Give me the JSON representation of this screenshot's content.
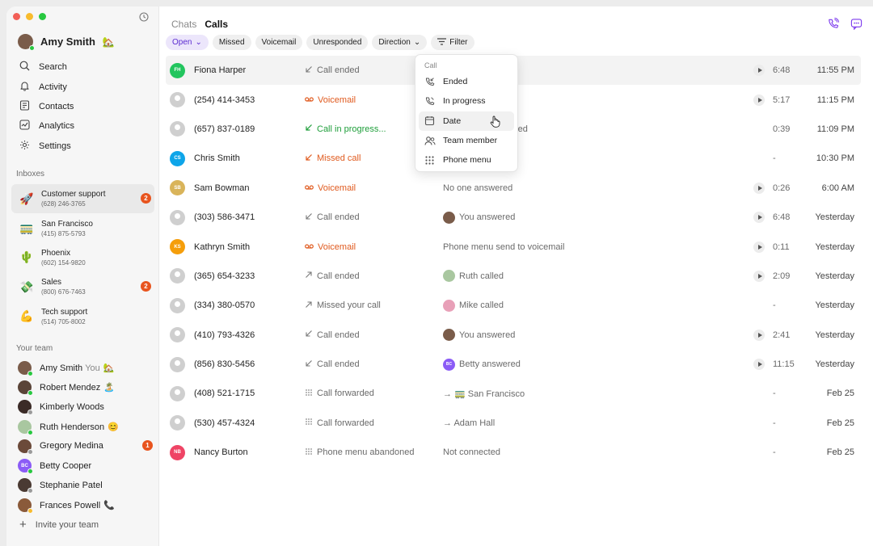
{
  "window": {
    "traffic_lights": [
      "#f25f57",
      "#f8bb2d",
      "#27c83f"
    ]
  },
  "user": {
    "name": "Amy Smith",
    "emoji": "🏡"
  },
  "nav": [
    {
      "label": "Search",
      "icon": "search-icon"
    },
    {
      "label": "Activity",
      "icon": "bell-icon"
    },
    {
      "label": "Contacts",
      "icon": "contacts-icon"
    },
    {
      "label": "Analytics",
      "icon": "analytics-icon"
    },
    {
      "label": "Settings",
      "icon": "gear-icon"
    }
  ],
  "inboxes_label": "Inboxes",
  "inboxes": [
    {
      "name": "Customer support",
      "phone": "(628) 246-3765",
      "emoji": "🚀",
      "badge": "2",
      "active": true
    },
    {
      "name": "San Francisco",
      "phone": "(415) 875-5793",
      "emoji": "🚃",
      "badge": "",
      "active": false
    },
    {
      "name": "Phoenix",
      "phone": "(602) 154-9820",
      "emoji": "🌵",
      "badge": "",
      "active": false
    },
    {
      "name": "Sales",
      "phone": "(800) 676-7463",
      "emoji": "💸",
      "badge": "2",
      "active": false
    },
    {
      "name": "Tech support",
      "phone": "(514) 705-8002",
      "emoji": "💪",
      "badge": "",
      "active": false
    }
  ],
  "team_label": "Your team",
  "team": [
    {
      "name": "Amy Smith",
      "you": "You",
      "emoji": "🏡",
      "color": "#7a5c4a",
      "status": "#27c83f",
      "badge": ""
    },
    {
      "name": "Robert Mendez",
      "you": "",
      "emoji": "🏝️",
      "color": "#5a4438",
      "status": "#27c83f",
      "badge": ""
    },
    {
      "name": "Kimberly Woods",
      "you": "",
      "emoji": "",
      "color": "#3b2b27",
      "status": "#9a9a9a",
      "badge": ""
    },
    {
      "name": "Ruth Henderson",
      "you": "",
      "emoji": "😊",
      "color": "#a9c7a0",
      "status": "#27c83f",
      "badge": ""
    },
    {
      "name": "Gregory Medina",
      "you": "",
      "emoji": "",
      "color": "#6b4a3a",
      "status": "#9a9a9a",
      "badge": "1"
    },
    {
      "name": "Betty Cooper",
      "you": "",
      "emoji": "",
      "color": "#8b5cf6",
      "status": "#27c83f",
      "badge": "",
      "initials": "BC"
    },
    {
      "name": "Stephanie Patel",
      "you": "",
      "emoji": "",
      "color": "#4a3a33",
      "status": "#9a9a9a",
      "badge": ""
    },
    {
      "name": "Frances Powell",
      "you": "",
      "emoji": "📞",
      "color": "#8a5a3a",
      "status": "#f8bb2d",
      "badge": ""
    }
  ],
  "invite_label": "Invite your team",
  "tabs": [
    {
      "label": "Chats",
      "active": false
    },
    {
      "label": "Calls",
      "active": true
    }
  ],
  "filters": [
    {
      "label": "Open",
      "dropdown": true,
      "open": true
    },
    {
      "label": "Missed",
      "dropdown": false
    },
    {
      "label": "Voicemail",
      "dropdown": false
    },
    {
      "label": "Unresponded",
      "dropdown": false
    },
    {
      "label": "Direction",
      "dropdown": true
    },
    {
      "label": "Filter",
      "icon": "filter-icon"
    }
  ],
  "calls": [
    {
      "name": "Fiona Harper",
      "avatar": "FH",
      "avatar_color": "#22c55e",
      "status": "Call ended",
      "type": "ended-in",
      "detail": "",
      "play": true,
      "duration": "6:48",
      "time": "11:55 PM",
      "highlight": true
    },
    {
      "name": "(254) 414-3453",
      "avatar": "",
      "avatar_color": "",
      "status": "Voicemail",
      "type": "vm",
      "detail": "",
      "play": true,
      "duration": "5:17",
      "time": "11:15 PM"
    },
    {
      "name": "(657) 837-0189",
      "avatar": "",
      "avatar_color": "",
      "status": "Call in progress...",
      "type": "prog",
      "detail": "red",
      "play": false,
      "duration": "0:39",
      "time": "11:09 PM"
    },
    {
      "name": "Chris Smith",
      "avatar": "CS",
      "avatar_color": "#0ea5e9",
      "status": "Missed call",
      "type": "miss",
      "detail": "",
      "play": false,
      "duration": "-",
      "time": "10:30 PM"
    },
    {
      "name": "Sam Bowman",
      "avatar": "SB",
      "avatar_color": "#d9b45a",
      "status": "Voicemail",
      "type": "vm",
      "detail": "No one answered",
      "play": true,
      "duration": "0:26",
      "time": "6:00 AM"
    },
    {
      "name": "(303) 586-3471",
      "avatar": "",
      "avatar_color": "",
      "status": "Call ended",
      "type": "ended-in",
      "detail": "You answered",
      "detail_avatar": "#7a5c4a",
      "play": true,
      "duration": "6:48",
      "time": "Yesterday"
    },
    {
      "name": "Kathryn Smith",
      "avatar": "KS",
      "avatar_color": "#f59e0b",
      "status": "Voicemail",
      "type": "vm",
      "detail": "Phone menu send to voicemail",
      "play": true,
      "duration": "0:11",
      "time": "Yesterday"
    },
    {
      "name": "(365) 654-3233",
      "avatar": "",
      "avatar_color": "",
      "status": "Call ended",
      "type": "ended-out",
      "detail": "Ruth called",
      "detail_avatar": "#a9c7a0",
      "play": true,
      "duration": "2:09",
      "time": "Yesterday"
    },
    {
      "name": "(334) 380-0570",
      "avatar": "",
      "avatar_color": "",
      "status": "Missed your call",
      "type": "ended-out",
      "detail": "Mike called",
      "detail_avatar": "#e8a0b8",
      "play": false,
      "duration": "-",
      "time": "Yesterday"
    },
    {
      "name": "(410) 793-4326",
      "avatar": "",
      "avatar_color": "",
      "status": "Call ended",
      "type": "ended-in",
      "detail": "You answered",
      "detail_avatar": "#7a5c4a",
      "play": true,
      "duration": "2:41",
      "time": "Yesterday"
    },
    {
      "name": "(856) 830-5456",
      "avatar": "",
      "avatar_color": "",
      "status": "Call ended",
      "type": "ended-in",
      "detail": "Betty answered",
      "detail_avatar": "#8b5cf6",
      "detail_initials": "BC",
      "play": true,
      "duration": "11:15",
      "time": "Yesterday"
    },
    {
      "name": "(408) 521-1715",
      "avatar": "",
      "avatar_color": "",
      "status": "Call forwarded",
      "type": "fwd",
      "detail": "→ 🚃 San Francisco",
      "play": false,
      "duration": "-",
      "time": "Feb 25"
    },
    {
      "name": "(530) 457-4324",
      "avatar": "",
      "avatar_color": "",
      "status": "Call forwarded",
      "type": "fwd",
      "detail": "→ Adam Hall",
      "play": false,
      "duration": "-",
      "time": "Feb 25"
    },
    {
      "name": "Nancy Burton",
      "avatar": "NB",
      "avatar_color": "#ef4465",
      "status": "Phone menu abandoned",
      "type": "fwd",
      "detail": "Not connected",
      "play": false,
      "duration": "-",
      "time": "Feb 25"
    }
  ],
  "dropdown": {
    "title": "Call",
    "items": [
      {
        "label": "Ended",
        "icon": "phone-ended-icon"
      },
      {
        "label": "In progress",
        "icon": "phone-progress-icon"
      },
      {
        "label": "Date",
        "icon": "calendar-icon",
        "hover": true
      },
      {
        "label": "Team member",
        "icon": "people-icon"
      },
      {
        "label": "Phone menu",
        "icon": "keypad-icon"
      }
    ]
  },
  "partial_detail": "red"
}
